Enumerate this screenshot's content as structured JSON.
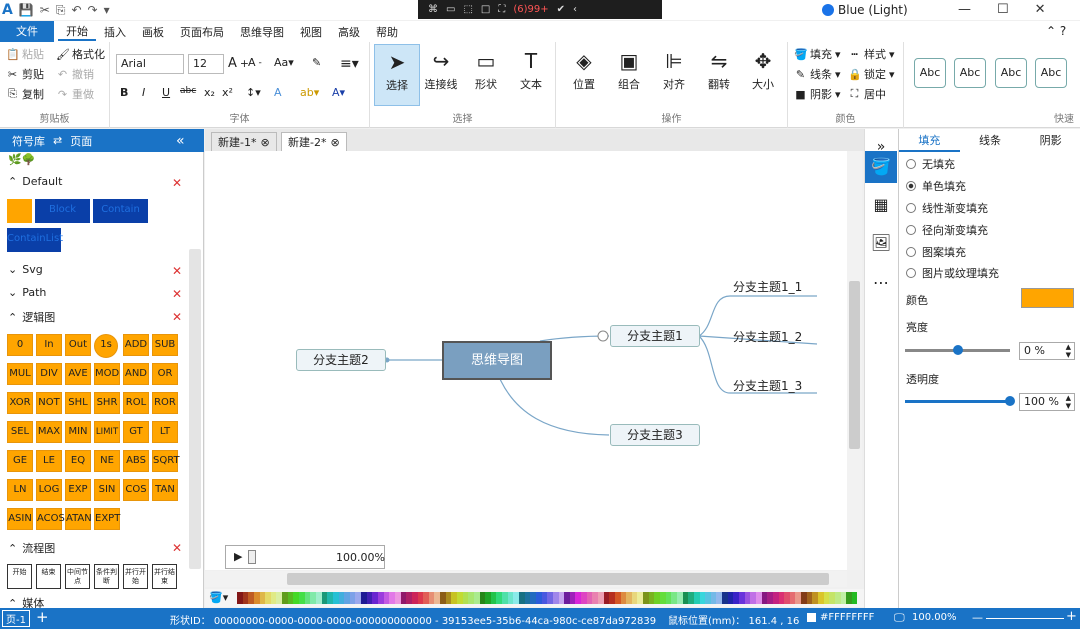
{
  "titlebar": {
    "float_badge": "(6)99+",
    "theme": "Blue (Light)"
  },
  "menu": {
    "file": "文件",
    "items": [
      "开始",
      "插入",
      "画板",
      "页面布局",
      "思维导图",
      "视图",
      "高级",
      "帮助"
    ]
  },
  "clipboard": {
    "paste": "粘贴",
    "cut": "剪贴",
    "copy": "复制",
    "format": "格式化",
    "undo": "撤销",
    "redo": "重做",
    "label": "剪贴板"
  },
  "font": {
    "family": "Arial",
    "size": "12",
    "label": "字体"
  },
  "select": {
    "select": "选择",
    "connector": "连接线",
    "shape": "形状",
    "text": "文本",
    "label": "选择"
  },
  "operation": {
    "position": "位置",
    "group": "组合",
    "align": "对齐",
    "flip": "翻转",
    "size": "大小",
    "label": "操作"
  },
  "color": {
    "fill": "填充",
    "line": "线条",
    "shadow": "阴影",
    "style": "样式",
    "lock": "锁定",
    "center": "居中",
    "label": "颜色"
  },
  "quickstyle": {
    "items": [
      "Abc",
      "Abc",
      "Abc",
      "Abc"
    ],
    "label": "快速"
  },
  "leftpanel": {
    "tab1": "符号库",
    "tab2": "页面",
    "default_section": "Default",
    "default_items": [
      "Block",
      "Contain",
      "ContainList"
    ],
    "svg_section": "Svg",
    "path_section": "Path",
    "logic_section": "逻辑图",
    "logic_items": [
      "0",
      "In",
      "Out",
      "1s",
      "ADD",
      "SUB",
      "MUL",
      "DIV",
      "AVE",
      "MOD",
      "AND",
      "OR",
      "XOR",
      "NOT",
      "SHL",
      "SHR",
      "ROL",
      "ROR",
      "SEL",
      "MAX",
      "MIN",
      "LIMIT",
      "GT",
      "LT",
      "GE",
      "LE",
      "EQ",
      "NE",
      "ABS",
      "SQRT",
      "LN",
      "LOG",
      "EXP",
      "SIN",
      "COS",
      "TAN",
      "ASIN",
      "ACOS",
      "ATAN",
      "EXPT"
    ],
    "flow_section": "流程图",
    "flow_items": [
      "开始",
      "结束",
      "中间节点",
      "条件判断",
      "并行开始",
      "并行结束"
    ],
    "media_section": "媒体"
  },
  "tabs": [
    "新建-1*",
    "新建-2*"
  ],
  "mindmap": {
    "root": "思维导图",
    "b1": "分支主题1",
    "b2": "分支主题2",
    "b3": "分支主题3",
    "s1": "分支主题1_1",
    "s2": "分支主题1_2",
    "s3": "分支主题1_3"
  },
  "player": {
    "zoom": "100.00%"
  },
  "rightpanel": {
    "tabs": [
      "填充",
      "线条",
      "阴影"
    ],
    "options": [
      "无填充",
      "单色填充",
      "线性渐变填充",
      "径向渐变填充",
      "图案填充",
      "图片或纹理填充"
    ],
    "selected_option": "单色填充",
    "color_label": "颜色",
    "fill_color": "#FFA500",
    "brightness_label": "亮度",
    "brightness_value": "0 %",
    "brightness": 0,
    "opacity_label": "透明度",
    "opacity_value": "100 %",
    "opacity": 100
  },
  "status": {
    "page": "页-1",
    "shape_id": "形状ID： 00000000-0000-0000-0000-000000000000 - 39153ee5-35b6-44ca-980c-ce87da972839",
    "mouse": "鼠标位置(mm)： 161.4 , 16",
    "color": "#FFFFFFFF",
    "zoom": "100.00%"
  }
}
